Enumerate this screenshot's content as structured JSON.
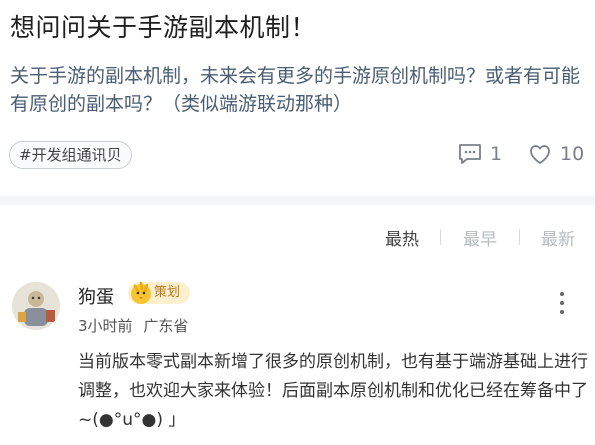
{
  "post": {
    "title": "想问问关于手游副本机制！",
    "content": "关于手游的副本机制，未来会有更多的手游原创机制吗？或者有可能有原创的副本吗？（类似端游联动那种）",
    "tag": "#开发组通讯贝",
    "comment_count": "1",
    "like_count": "10"
  },
  "sort": {
    "options": [
      "最热",
      "最早",
      "最新"
    ],
    "active": "最热"
  },
  "comment": {
    "author": "狗蛋",
    "badge": "策划",
    "time": "3小时前",
    "location": "广东省",
    "text": "当前版本零式副本新增了很多的原创机制，也有基于端游基础上进行调整，也欢迎大家来体验！后面副本原创机制和优化已经在筹备中了~(●°u°●)​ 」"
  },
  "icons": {
    "comment": "comment-icon",
    "like": "heart-icon",
    "more": "more-vertical-icon",
    "badge": "chocobo-badge-icon"
  },
  "colors": {
    "muted": "#7a8089",
    "badge_bg": "#fdf0cf",
    "badge_text": "#b7791a",
    "content_text": "#4a5d72"
  }
}
